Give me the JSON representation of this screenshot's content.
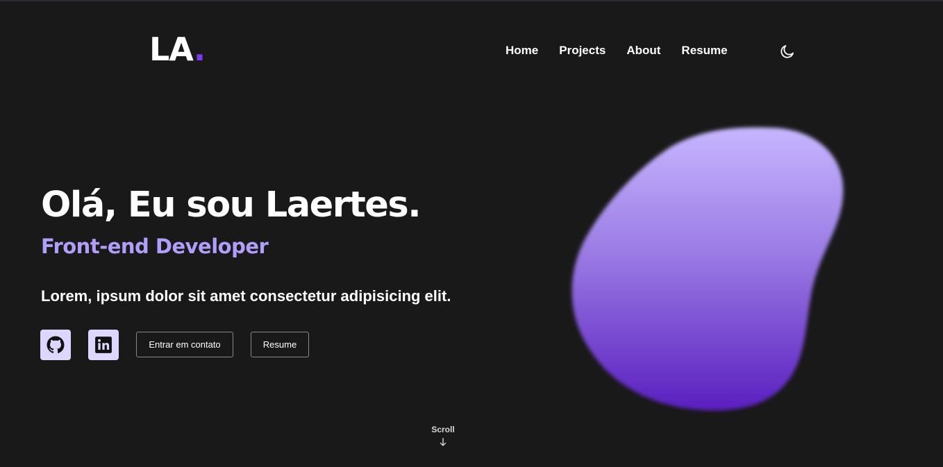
{
  "header": {
    "logo_text": "LA",
    "logo_dot": ".",
    "nav": [
      {
        "label": "Home"
      },
      {
        "label": "Projects"
      },
      {
        "label": "About"
      },
      {
        "label": "Resume"
      }
    ],
    "theme_icon": "moon-icon"
  },
  "hero": {
    "title": "Olá, Eu sou Laertes.",
    "role": "Front-end Developer",
    "description": "Lorem, ipsum dolor sit amet consectetur adipisicing elit.",
    "social": [
      {
        "icon": "github-icon"
      },
      {
        "icon": "linkedin-icon"
      }
    ],
    "buttons": {
      "contact_label": "Entrar em contato",
      "resume_label": "Resume"
    }
  },
  "scroll": {
    "label": "Scroll",
    "icon": "arrow-down-icon"
  },
  "colors": {
    "background": "#191919",
    "accent": "#7c3aed",
    "accent_light": "#b39dfa",
    "social_bg": "#ddd6fe",
    "blob_top": "#c4b5fd",
    "blob_bottom": "#5b21b6"
  }
}
